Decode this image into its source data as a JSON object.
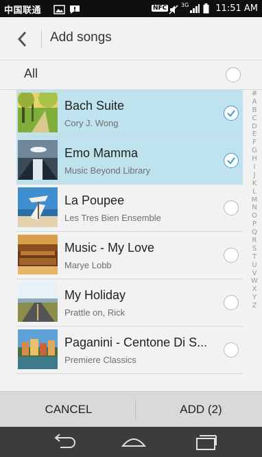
{
  "status": {
    "carrier": "中国联通",
    "network": "3G",
    "nfc": "NFC",
    "time": "11:51 AM"
  },
  "header": {
    "title": "Add songs"
  },
  "all_row": {
    "label": "All"
  },
  "songs": [
    {
      "title": "Bach Suite",
      "artist": "Cory J. Wong",
      "selected": true
    },
    {
      "title": "Emo Mamma",
      "artist": "Music Beyond Library",
      "selected": true
    },
    {
      "title": "La Poupee",
      "artist": "Les Tres Bien Ensemble",
      "selected": false
    },
    {
      "title": "Music - My Love",
      "artist": "Marye Lobb",
      "selected": false
    },
    {
      "title": "My Holiday",
      "artist": "Prattle on, Rick",
      "selected": false
    },
    {
      "title": "Paganini - Centone Di S...",
      "artist": "Premiere Classics",
      "selected": false
    }
  ],
  "index_letters": [
    "#",
    "A",
    "B",
    "C",
    "D",
    "E",
    "F",
    "G",
    "H",
    "I",
    "J",
    "K",
    "L",
    "M",
    "N",
    "O",
    "P",
    "Q",
    "R",
    "S",
    "T",
    "U",
    "V",
    "W",
    "X",
    "Y",
    "Z"
  ],
  "actions": {
    "cancel": "CANCEL",
    "add": "ADD (2)"
  },
  "colors": {
    "selected_row": "#bfe3ee",
    "accent": "#3a9ad6"
  },
  "icons": {
    "back": "chevron-left-icon",
    "nav_back": "back-arrow-icon",
    "nav_home": "home-icon",
    "nav_recents": "recents-icon"
  }
}
